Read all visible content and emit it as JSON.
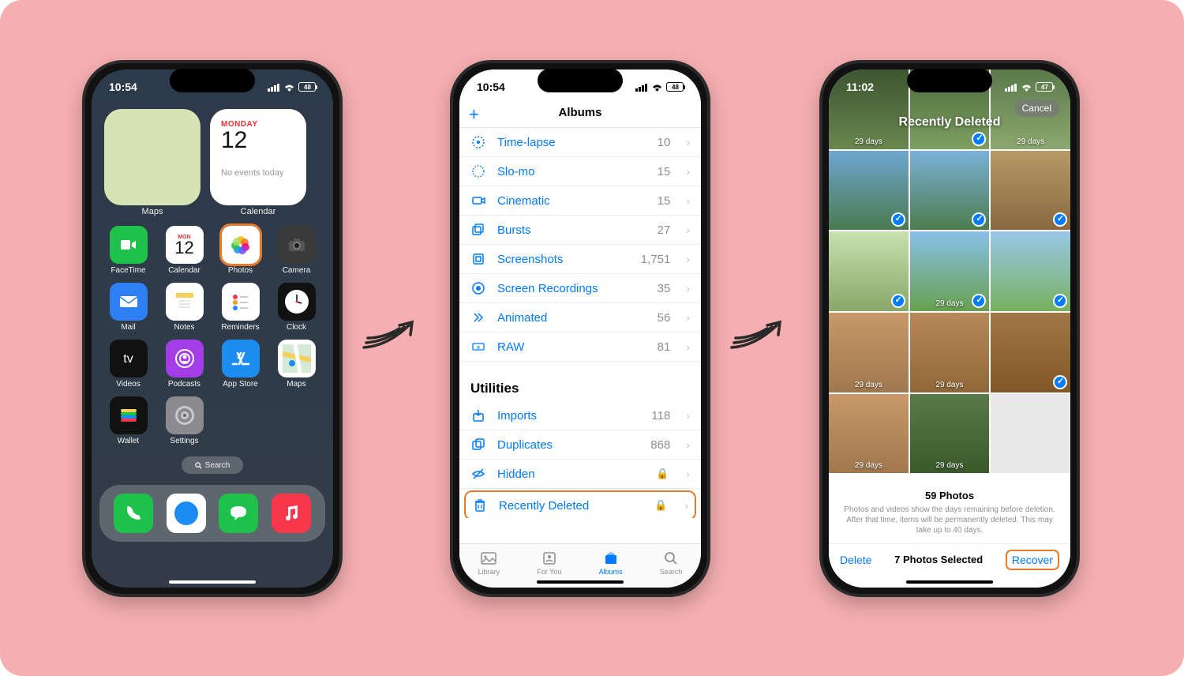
{
  "phone1": {
    "time": "10:54",
    "battery": "48",
    "widget_day": "MONDAY",
    "widget_date": "12",
    "widget_none": "No events today",
    "widget_maps_label": "Maps",
    "widget_cal_label": "Calendar",
    "apps_row1": [
      {
        "name": "FaceTime",
        "bg": "#1ec24a"
      },
      {
        "name": "Calendar",
        "bg": "#fff",
        "mini_day": "MON",
        "mini_num": "12"
      },
      {
        "name": "Photos",
        "bg": "#fff",
        "highlighted": true
      },
      {
        "name": "Camera",
        "bg": "#3a3a3a"
      }
    ],
    "apps_row2": [
      {
        "name": "Mail",
        "bg": "#2e7ff3"
      },
      {
        "name": "Notes",
        "bg": "#fff"
      },
      {
        "name": "Reminders",
        "bg": "#fff"
      },
      {
        "name": "Clock",
        "bg": "#111"
      }
    ],
    "apps_row3": [
      {
        "name": "Videos",
        "bg": "#111"
      },
      {
        "name": "Podcasts",
        "bg": "#a33de8"
      },
      {
        "name": "App Store",
        "bg": "#1d8df2"
      },
      {
        "name": "Maps",
        "bg": "#fff"
      }
    ],
    "apps_row4": [
      {
        "name": "Wallet",
        "bg": "#111"
      },
      {
        "name": "Settings",
        "bg": "#8b8b8e"
      }
    ],
    "search": "Search",
    "dock": [
      {
        "name": "Phone",
        "bg": "#1ec24a"
      },
      {
        "name": "Safari",
        "bg": "#fff"
      },
      {
        "name": "Messages",
        "bg": "#1ec24a"
      },
      {
        "name": "Music",
        "bg": "#f7374c"
      }
    ]
  },
  "phone2": {
    "time": "10:54",
    "battery": "48",
    "title": "Albums",
    "rows": [
      {
        "label": "Time-lapse",
        "count": "10"
      },
      {
        "label": "Slo-mo",
        "count": "15"
      },
      {
        "label": "Cinematic",
        "count": "15"
      },
      {
        "label": "Bursts",
        "count": "27"
      },
      {
        "label": "Screenshots",
        "count": "1,751"
      },
      {
        "label": "Screen Recordings",
        "count": "35"
      },
      {
        "label": "Animated",
        "count": "56"
      },
      {
        "label": "RAW",
        "count": "81"
      }
    ],
    "section": "Utilities",
    "util_rows": [
      {
        "label": "Imports",
        "count": "118"
      },
      {
        "label": "Duplicates",
        "count": "868"
      },
      {
        "label": "Hidden",
        "locked": true
      },
      {
        "label": "Recently Deleted",
        "locked": true,
        "highlighted": true
      }
    ],
    "tabs": [
      {
        "label": "Library"
      },
      {
        "label": "For You"
      },
      {
        "label": "Albums",
        "active": true
      },
      {
        "label": "Search"
      }
    ]
  },
  "phone3": {
    "time": "11:02",
    "battery": "47",
    "title": "Recently Deleted",
    "cancel": "Cancel",
    "thumbs": [
      {
        "bg": "linear-gradient(#3d5530,#6a8750)",
        "days": "29 days"
      },
      {
        "bg": "linear-gradient(#4a6a3d,#7ea060)",
        "days": "",
        "checked": true
      },
      {
        "bg": "linear-gradient(#5a7a4a,#8da870)",
        "days": "29 days"
      },
      {
        "bg": "linear-gradient(#6fa6d0,#4a7a50)",
        "days": "",
        "checked": true
      },
      {
        "bg": "linear-gradient(#7ab0d8,#4d7d4d)",
        "days": "",
        "checked": true
      },
      {
        "bg": "linear-gradient(#b89868,#8a6840)",
        "days": "",
        "checked": true
      },
      {
        "bg": "linear-gradient(#c8e0b0,#88a868)",
        "days": "",
        "checked": true
      },
      {
        "bg": "linear-gradient(#88c0e8,#68a050)",
        "days": "29 days",
        "checked": true
      },
      {
        "bg": "linear-gradient(#98c8e8,#78b060)",
        "days": "",
        "checked": true
      },
      {
        "bg": "linear-gradient(#c89868,#a07850)",
        "days": "29 days"
      },
      {
        "bg": "linear-gradient(#b88858,#906838)",
        "days": "29 days"
      },
      {
        "bg": "linear-gradient(#a07848,#805828)",
        "days": "",
        "checked": true
      },
      {
        "bg": "linear-gradient(#c89868,#a07850)",
        "days": "29 days"
      },
      {
        "bg": "linear-gradient(#5a7a4a,#3a5a2a)",
        "days": "29 days"
      },
      {
        "bg": "#e8e8e8",
        "days": ""
      }
    ],
    "count_title": "59 Photos",
    "desc": "Photos and videos show the days remaining before deletion. After that time, items will be permanently deleted. This may take up to 40 days.",
    "delete": "Delete",
    "selected": "7 Photos Selected",
    "recover": "Recover"
  }
}
